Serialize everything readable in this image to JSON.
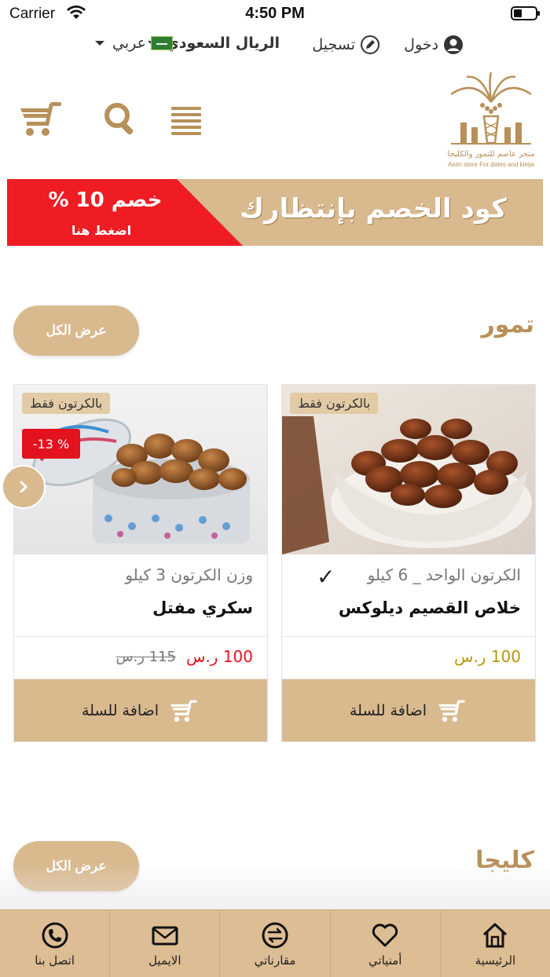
{
  "status_bar": {
    "carrier": "Carrier",
    "time": "4:50 PM"
  },
  "top_links": {
    "login": "دخول",
    "register": "تسجيل",
    "currency": "الريال السعودي",
    "language": "عربي"
  },
  "logo": {
    "text_ar": "متجر عاصم للتمور والكليجا",
    "text_en": "Asim store For dates and kleija"
  },
  "promo": {
    "discount": "خصم 10 %",
    "tap_here": "اضغط هنا",
    "code_text": "كود الخصم بإنتظارك"
  },
  "sections": [
    {
      "title": "تمور",
      "view_all": "عرض الكل"
    },
    {
      "title": "كليجا",
      "view_all": "عرض الكل"
    }
  ],
  "products": [
    {
      "badge": "بالكرتون فقط",
      "weight": "الكرتون الواحد _ 6 كيلو",
      "name": "خلاص القصيم ديلوكس",
      "price": "100 ر.س",
      "add_to_cart": "اضافة للسلة",
      "check": "✓"
    },
    {
      "badge": "بالكرتون فقط",
      "discount": "-13 %",
      "weight": "وزن الكرتون 3 كيلو",
      "name": "سكري مفتل",
      "price": "100 ر.س",
      "old_price": "115 ر.س",
      "add_to_cart": "اضافة للسلة"
    }
  ],
  "tabbar": [
    {
      "label": "الرئيسية",
      "icon": "home-icon"
    },
    {
      "label": "أمنياتي",
      "icon": "heart-icon"
    },
    {
      "label": "مقارناتي",
      "icon": "compare-icon"
    },
    {
      "label": "الايميل",
      "icon": "mail-icon"
    },
    {
      "label": "اتصل بنا",
      "icon": "phone-icon"
    }
  ],
  "colors": {
    "brand": "#d9b98e",
    "brand_text": "#b8905a",
    "sale_red": "#ef1c23",
    "price_gold": "#b8960c"
  }
}
